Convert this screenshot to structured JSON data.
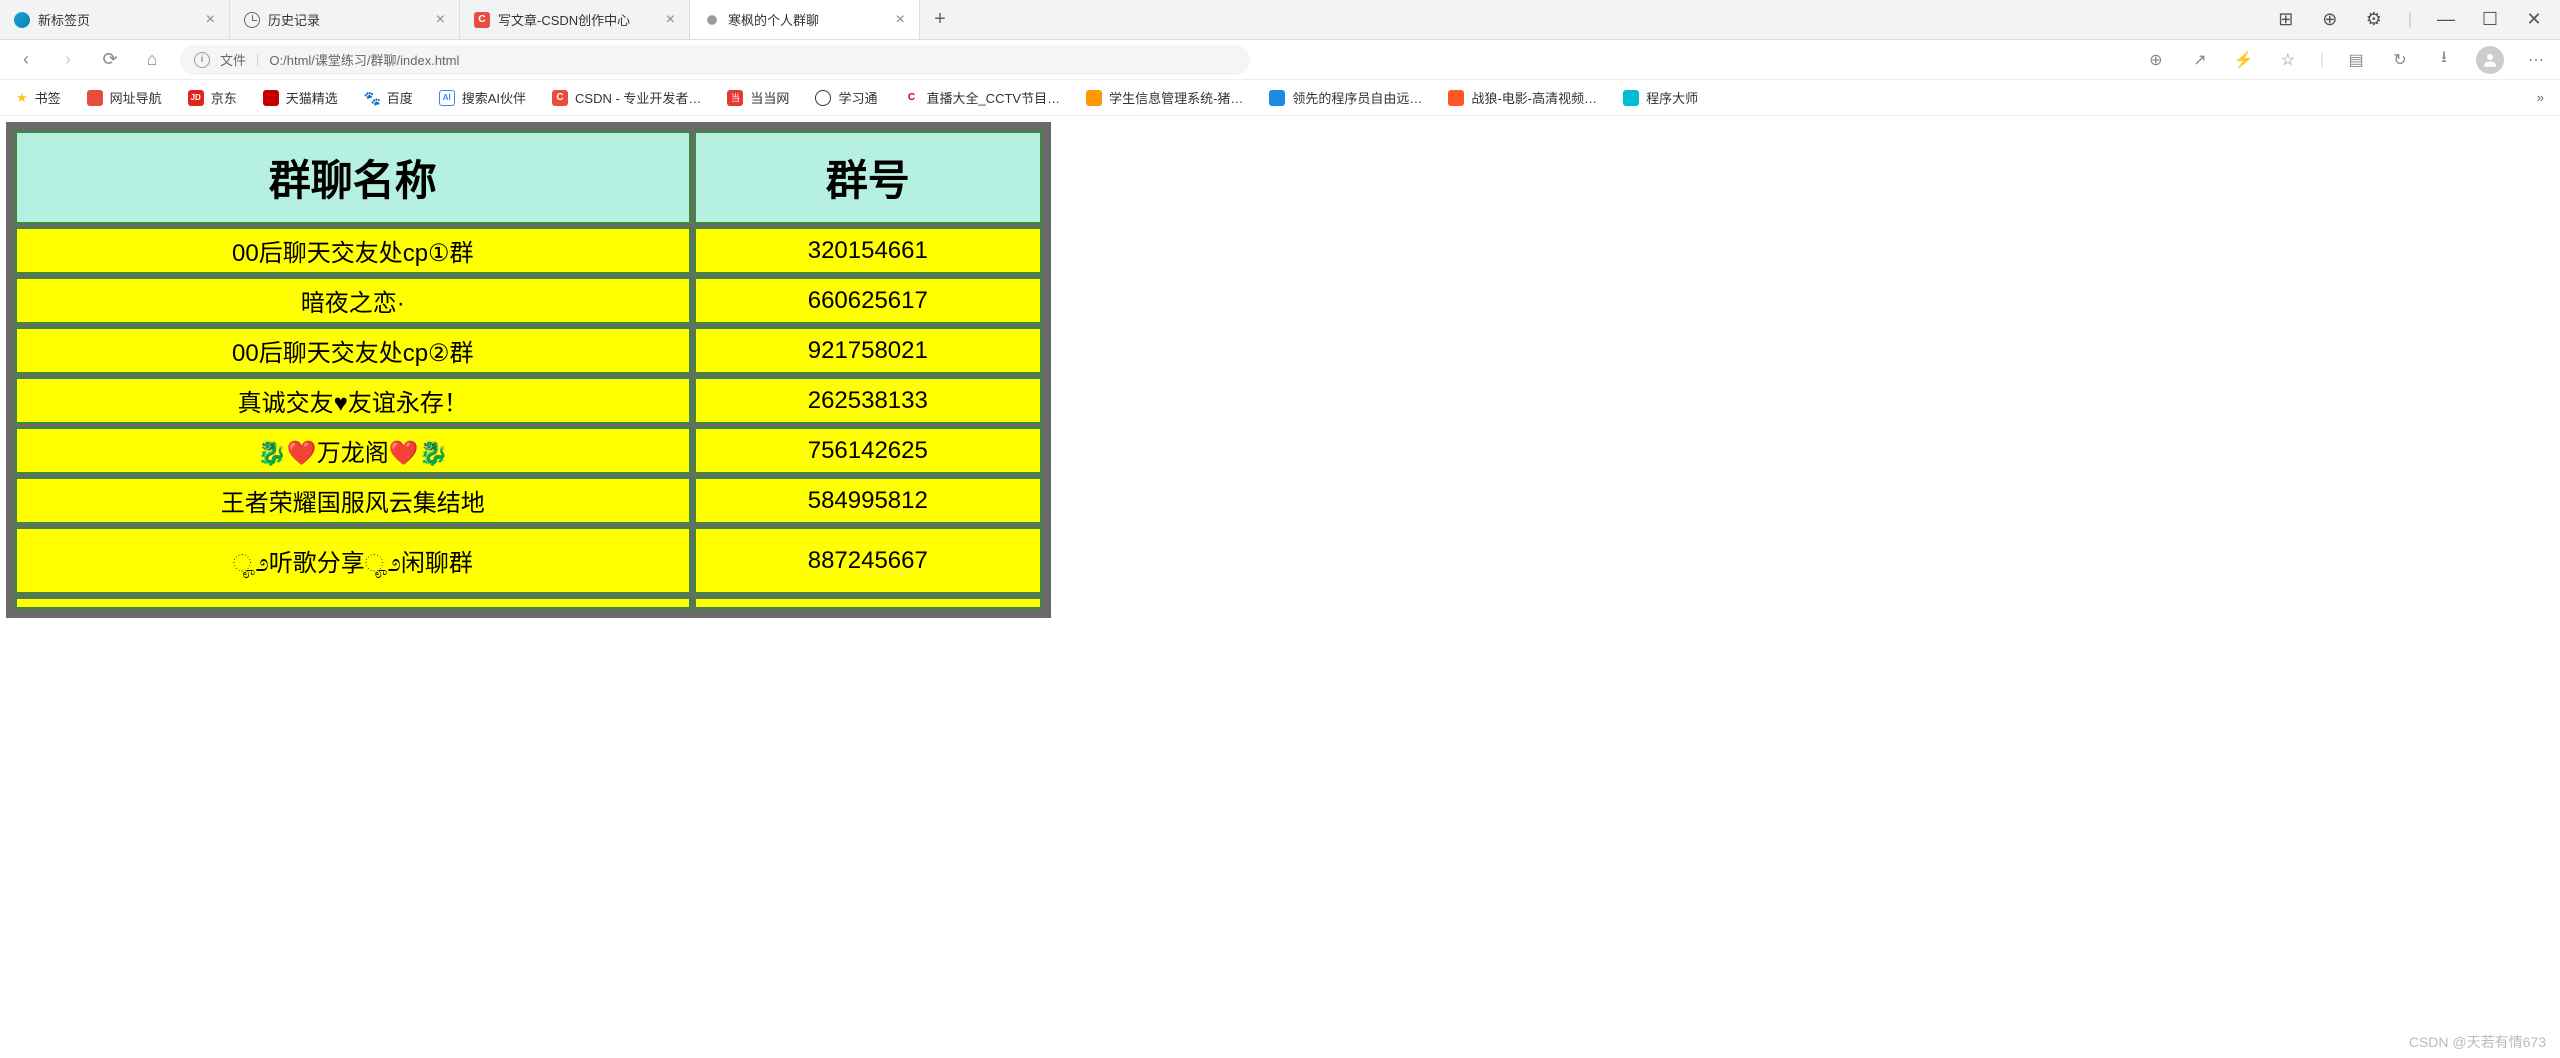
{
  "colors": {
    "header_bg": "#b6f0e0",
    "cell_bg": "#ffff00",
    "outer_border": "#6a6a6a",
    "inner_border": "#3d8a3d"
  },
  "tabs": [
    {
      "title": "新标签页",
      "icon_color": "#1aa5d8",
      "active": false
    },
    {
      "title": "历史记录",
      "icon_color": "#666666",
      "active": false,
      "clock": true
    },
    {
      "title": "写文章-CSDN创作中心",
      "icon_color": "#e74c3c",
      "active": false,
      "letter": "C"
    },
    {
      "title": "寒枫的个人群聊",
      "icon_color": "#555",
      "active": true
    }
  ],
  "newtab_label": "+",
  "addressbar": {
    "file_label": "文件",
    "url": "O:/html/课堂练习/群聊/index.html",
    "separator": "|"
  },
  "bookmarks": [
    {
      "label": "书签",
      "icon_color": "#f5c518",
      "star": true
    },
    {
      "label": "网址导航",
      "icon_color": "#e74c3c"
    },
    {
      "label": "京东",
      "icon_color": "#e1251b",
      "letter": "JD"
    },
    {
      "label": "天猫精选",
      "icon_color": "#c40000"
    },
    {
      "label": "百度",
      "icon_color": "#2932e1",
      "paw": true
    },
    {
      "label": "搜索AI伙伴",
      "icon_color": "#4285f4",
      "letter": "AI"
    },
    {
      "label": "CSDN - 专业开发者…",
      "icon_color": "#e74c3c",
      "letter": "C"
    },
    {
      "label": "当当网",
      "icon_color": "#e53935"
    },
    {
      "label": "学习通",
      "icon_color": "#333"
    },
    {
      "label": "直播大全_CCTV节目…",
      "icon_color": "#cc0000",
      "letter": "C"
    },
    {
      "label": "学生信息管理系统-猪…",
      "icon_color": "#ff9800"
    },
    {
      "label": "领先的程序员自由远…",
      "icon_color": "#1e88e5"
    },
    {
      "label": "战狼-电影-高清视频…",
      "icon_color": "#ff5722"
    },
    {
      "label": "程序大师",
      "icon_color": "#00bcd4"
    }
  ],
  "bookmarks_more": "»",
  "table": {
    "headers": {
      "name": "群聊名称",
      "number": "群号"
    },
    "rows": [
      {
        "name": "00后聊天交友处cp①群",
        "number": "320154661"
      },
      {
        "name": "暗夜之恋·",
        "number": "660625617"
      },
      {
        "name": "00后聊天交友处cp②群",
        "number": "921758021"
      },
      {
        "name": "真诚交友♥友谊永存！",
        "number": "262538133"
      },
      {
        "name": "🐉❤️万龙阁❤️🐉",
        "number": "756142625"
      },
      {
        "name": "王者荣耀国服风云集结地",
        "number": "584995812"
      },
      {
        "name": "ೄ೨听歌分享ೄ೨闲聊群",
        "number": "887245667"
      }
    ]
  },
  "watermark": "CSDN @天若有情673",
  "win_controls": {
    "min": "—",
    "max": "☐",
    "close": "✕"
  }
}
